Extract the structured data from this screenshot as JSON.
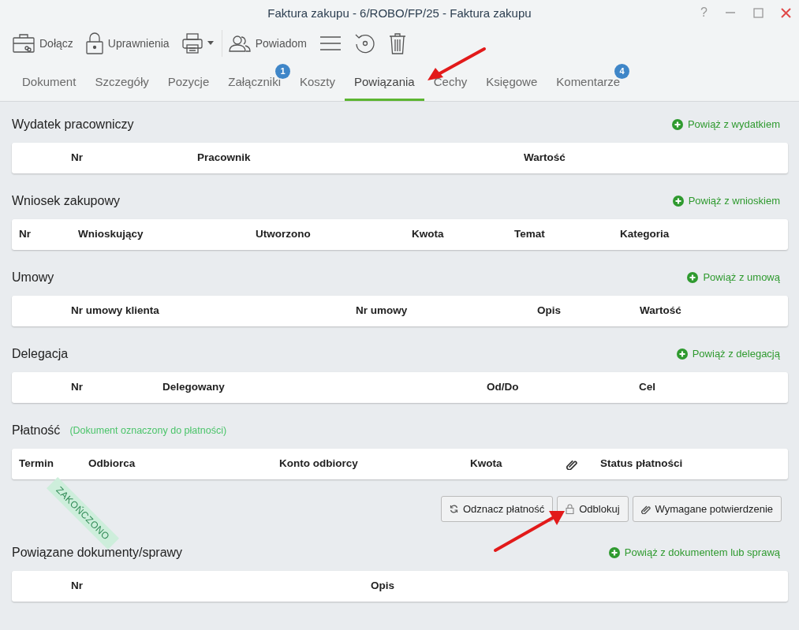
{
  "window": {
    "title": "Faktura zakupu - 6/ROBO/FP/25 - Faktura zakupu",
    "controls": [
      "?"
    ]
  },
  "toolbar": [
    {
      "kind": "text",
      "label": "Dołącz"
    },
    {
      "kind": "text",
      "label": "Uprawnienia"
    },
    {
      "kind": "icon"
    },
    {
      "kind": "text",
      "label": "Powiadom"
    },
    {
      "kind": "icon"
    },
    {
      "kind": "icon"
    },
    {
      "kind": "icon"
    }
  ],
  "tabs": [
    {
      "label": "Dokument",
      "selected": false
    },
    {
      "label": "Szczegóły",
      "selected": false
    },
    {
      "label": "Pozycje",
      "selected": false
    },
    {
      "label": "Załączniki",
      "selected": false,
      "badge": "1"
    },
    {
      "label": "Koszty",
      "selected": false
    },
    {
      "label": "Powiązania",
      "selected": true
    },
    {
      "label": "Cechy",
      "selected": false
    },
    {
      "label": "Księgowe",
      "selected": false
    },
    {
      "label": "Komentarze",
      "selected": false,
      "badge": "4"
    }
  ],
  "sections": [
    {
      "title": "Wydatek pracowniczy",
      "link": "Powiąż z wydatkiem",
      "columns": [
        "Nr",
        "Pracownik",
        "Wartość"
      ]
    },
    {
      "title": "Wniosek zakupowy",
      "link": "Powiąż z wnioskiem",
      "columns": [
        "Nr",
        "Wnioskujący",
        "Utworzono",
        "Kwota",
        "Temat",
        "Kategoria"
      ]
    },
    {
      "title": "Umowy",
      "link": "Powiąż z umową",
      "columns": [
        "Nr umowy klienta",
        "Nr umowy",
        "Opis",
        "Wartość"
      ]
    },
    {
      "title": "Delegacja",
      "link": "Powiąż z delegacją",
      "columns": [
        "Nr",
        "Delegowany",
        "Od/Do",
        "Cel"
      ]
    },
    {
      "title": "Płatność",
      "subtitle": "(Dokument oznaczony do płatności)",
      "columns": [
        "Termin",
        "Odbiorca",
        "Konto odbiorcy",
        "Kwota",
        "",
        "Status płatności"
      ],
      "buttons": [
        "Odznacz płatność",
        "Odblokuj",
        "Wymagane potwierdzenie"
      ]
    },
    {
      "title": "Powiązane dokumenty/sprawy",
      "link": "Powiąż z dokumentem lub sprawą",
      "columns": [
        "Nr",
        "Opis"
      ]
    }
  ],
  "status_ribbon": "ZAKOŃCZONO"
}
